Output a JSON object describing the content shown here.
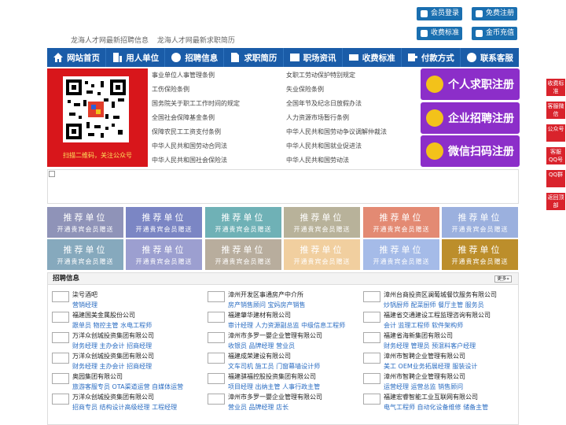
{
  "top_links": [
    "龙海人才网最新招聘信息",
    "龙海人才网最新求职简历"
  ],
  "top_buttons": [
    {
      "label": "会员登录",
      "icon": "user-icon"
    },
    {
      "label": "免费注册",
      "icon": "register-icon"
    },
    {
      "label": "收费标准",
      "icon": "price-icon"
    },
    {
      "label": "金币充值",
      "icon": "coin-icon"
    }
  ],
  "nav": [
    {
      "label": "网站首页",
      "icon": "home-icon"
    },
    {
      "label": "用人单位",
      "icon": "building-icon"
    },
    {
      "label": "招聘信息",
      "icon": "recruit-icon"
    },
    {
      "label": "求职简历",
      "icon": "resume-icon"
    },
    {
      "label": "职场资讯",
      "icon": "news-icon"
    },
    {
      "label": "收费标准",
      "icon": "price-icon"
    },
    {
      "label": "付款方式",
      "icon": "payment-icon"
    },
    {
      "label": "联系客服",
      "icon": "service-icon"
    }
  ],
  "qr_caption": "扫描二维码，关注公众号",
  "laws": [
    "事业单位人事管理条例",
    "女职工劳动保护特别规定",
    "工伤保险条例",
    "失业保险条例",
    "国务院关于职工工作时间的规定",
    "全国年节及纪念日放假办法",
    "全国社会保障基金条例",
    "人力资源市场暂行条例",
    "保障农民工工资支付条例",
    "中华人民共和国劳动争议调解仲裁法",
    "中华人民共和国劳动合同法",
    "中华人民共和国就业促进法",
    "中华人民共和国社会保险法",
    "中华人民共和国劳动法"
  ],
  "register": [
    "个人求职注册",
    "企业招聘注册",
    "微信扫码注册"
  ],
  "ad_title": "推荐单位",
  "ad_sub": "开通贵宾会员赠送",
  "ad_colors": [
    "#8f93b8",
    "#7b86c4",
    "#6fb1b6",
    "#b8b29a",
    "#e38a73",
    "#9bb0de",
    "#86a9bd",
    "#9c9fd0",
    "#b8ad9d",
    "#f1cf9f",
    "#a5bbe8",
    "#bc8e2b"
  ],
  "jobs_title": "招聘信息",
  "more_label": "更多»",
  "companies": [
    {
      "name": "柒号酒吧",
      "positions": "营销经理"
    },
    {
      "name": "漳州开发区事通房产中介所",
      "positions": "房产销售顾问 宝妈房产销售"
    },
    {
      "name": "漳州台商投资区澜葡城餐饮服务有限公司",
      "positions": "炒锅厨师 配菜厨师 餐厅主管 服务员"
    },
    {
      "name": "福建国美金属股份公司",
      "positions": "跟单员 物控主管 水电工程师"
    },
    {
      "name": "福建肇华建材有限公司",
      "positions": "审计经理 人力资源副总监 中级信息工程师"
    },
    {
      "name": "福建省交通建设工程监理咨询有限公司",
      "positions": "会计 监理工程师 软件架构师"
    },
    {
      "name": "万洋众创城投资集团有限公司",
      "positions": "财务经理 主办会计 招商经理"
    },
    {
      "name": "漳州市多罗一嬰企业管理有限公司",
      "positions": "收银员 品牌经理 营业员"
    },
    {
      "name": "福建省海新集团有限公司",
      "positions": "财务经理 管理员 预混料客户经理"
    },
    {
      "name": "万洋众创城投资集团有限公司",
      "positions": "财务经理 主办会计 招商经理"
    },
    {
      "name": "福建成荣建设有限公司",
      "positions": "文车司机 施工员 门窗幕墙设计师"
    },
    {
      "name": "漳州市智聘企业管理有限公司",
      "positions": "美工 OEM业务拓展经理 服装设计"
    },
    {
      "name": "奥园集团有限公司",
      "positions": "旅游客服专员 OTA渠道运营 自媒体运营"
    },
    {
      "name": "福建骐福控股投资集团有限公司",
      "positions": "项目经理 出纳主管 人事行政主管"
    },
    {
      "name": "漳州市智聘企业管理有限公司",
      "positions": "运营经理 运营总监 销售顾问"
    },
    {
      "name": "万洋众创城投资集团有限公司",
      "positions": "招商专员 结构设计高级经理 工程经理"
    },
    {
      "name": "漳州市多罗一嬰企业管理有限公司",
      "positions": "营业员 品牌经理 店长"
    },
    {
      "name": "福建宏睿智能工业互联网有限公司",
      "positions": "电气工程师 自动化设备维修 储备主管"
    }
  ],
  "side": [
    "收费标准",
    "客服微信",
    "公众号",
    "客服QQ号",
    "QQ群",
    "返回顶部"
  ]
}
